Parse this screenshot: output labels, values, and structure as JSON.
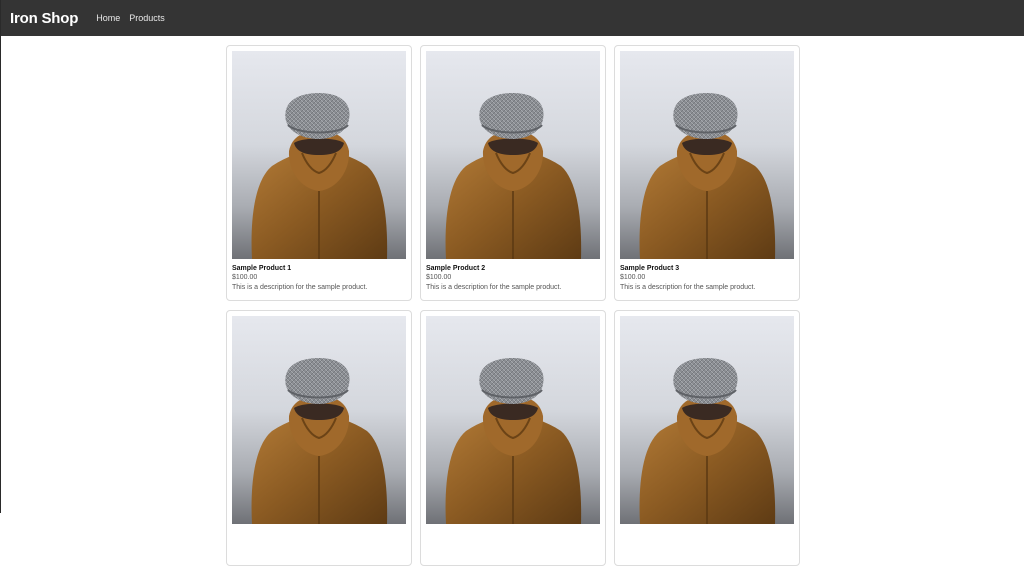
{
  "nav": {
    "brand": "Iron Shop",
    "links": [
      "Home",
      "Products"
    ]
  },
  "products": [
    {
      "title": "Sample Product 1",
      "price": "$100.00",
      "description": "This is a description for the sample product."
    },
    {
      "title": "Sample Product 2",
      "price": "$100.00",
      "description": "This is a description for the sample product."
    },
    {
      "title": "Sample Product 3",
      "price": "$100.00",
      "description": "This is a description for the sample product."
    },
    {
      "title": "",
      "price": "",
      "description": ""
    },
    {
      "title": "",
      "price": "",
      "description": ""
    },
    {
      "title": "",
      "price": "",
      "description": ""
    }
  ],
  "colors": {
    "navbar": "#343434",
    "jacket": "#8a5a22",
    "beanie": "#8c8f94"
  }
}
